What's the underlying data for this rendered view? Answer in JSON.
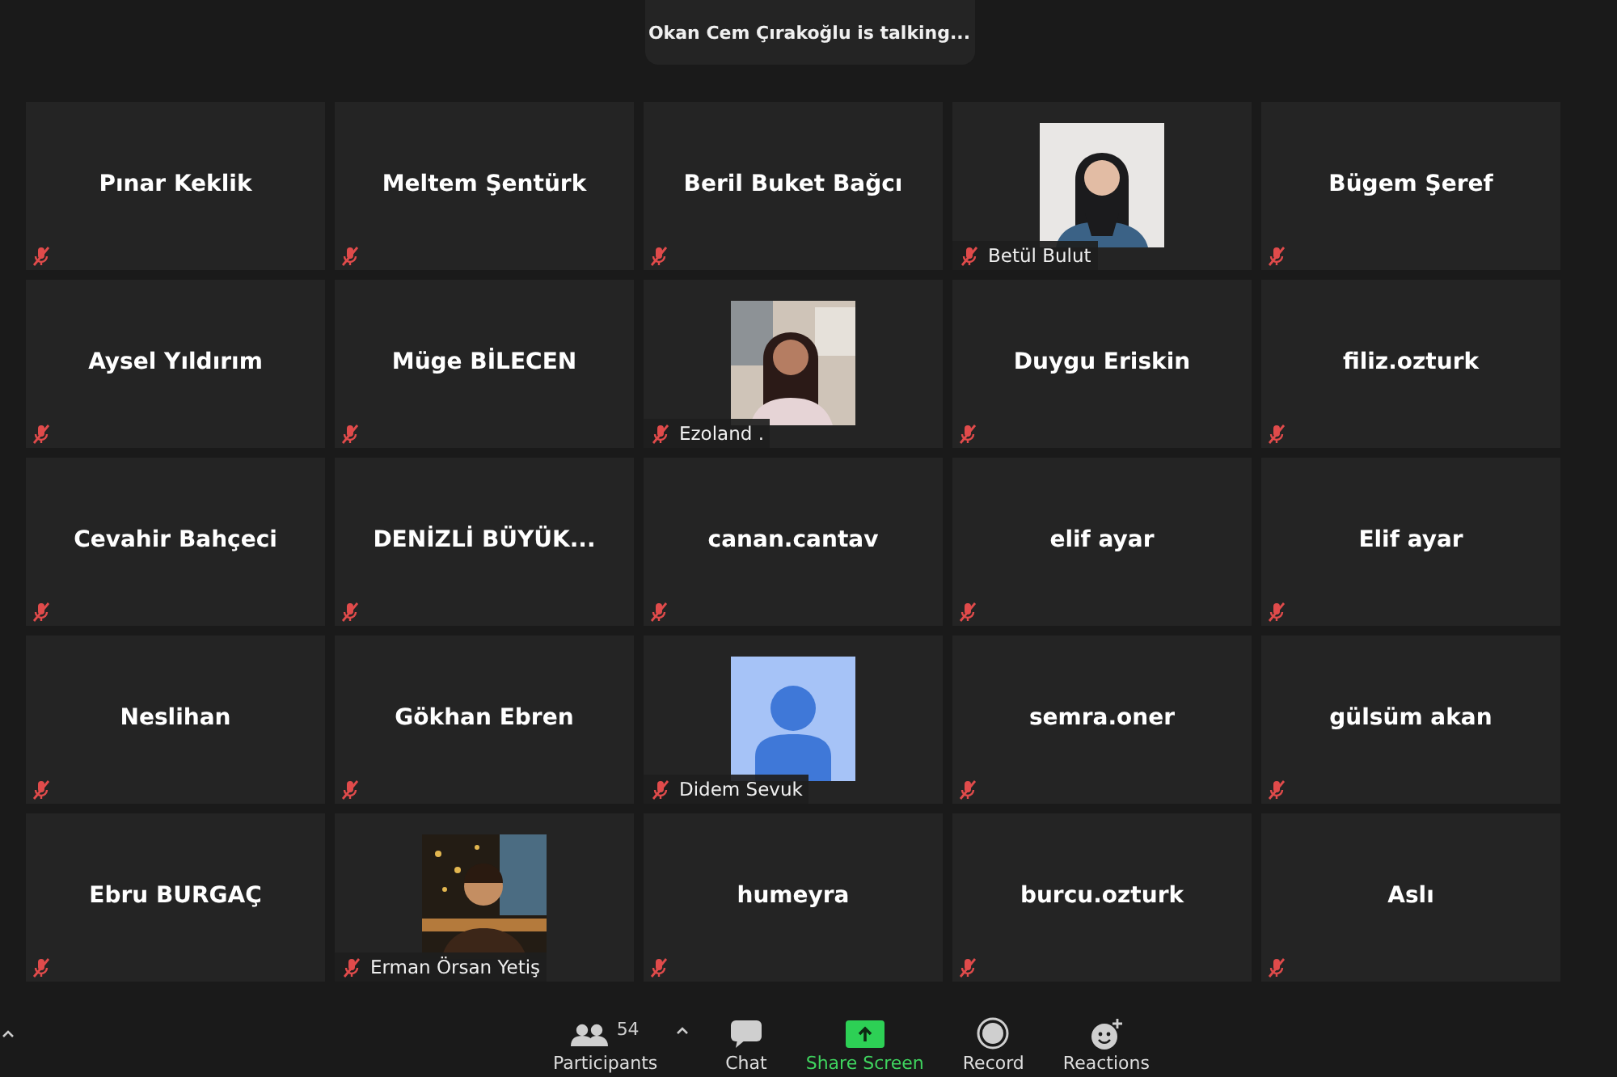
{
  "banner": {
    "text": "Okan Cem Çırakoğlu is talking..."
  },
  "tiles": [
    {
      "name": "Pınar Keklik",
      "kind": "name",
      "muted": true
    },
    {
      "name": "Meltem Şentürk",
      "kind": "name",
      "muted": true
    },
    {
      "name": "Beril Buket Bağcı",
      "kind": "name",
      "muted": true
    },
    {
      "name": "Betül Bulut",
      "muted": true
    },
    {
      "name": "Bügem Şeref",
      "kind": "name",
      "muted": true
    },
    {
      "name": "Aysel Yıldırım",
      "kind": "name",
      "muted": true
    },
    {
      "name": "Müge BİLECEN",
      "kind": "name",
      "muted": true
    },
    {
      "name": "Ezoland .",
      "muted": true
    },
    {
      "name": "Duygu Eriskin",
      "kind": "name",
      "muted": true
    },
    {
      "name": "filiz.ozturk",
      "kind": "name",
      "muted": true
    },
    {
      "name": "Cevahir Bahçeci",
      "kind": "name",
      "muted": true
    },
    {
      "name": "DENİZLİ BÜYÜK...",
      "kind": "name",
      "muted": true
    },
    {
      "name": "canan.cantav",
      "kind": "name",
      "muted": true
    },
    {
      "name": "elif ayar",
      "kind": "name",
      "muted": true
    },
    {
      "name": "Elif ayar",
      "kind": "name",
      "muted": true
    },
    {
      "name": "Neslihan",
      "kind": "name",
      "muted": true
    },
    {
      "name": "Gökhan Ebren",
      "kind": "name",
      "muted": true
    },
    {
      "name": "Didem Sevuk",
      "kind": "avatar",
      "muted": true
    },
    {
      "name": "semra.oner",
      "kind": "name",
      "muted": true
    },
    {
      "name": "gülsüm akan",
      "kind": "name",
      "muted": true
    },
    {
      "name": "Ebru BURGAÇ",
      "kind": "name",
      "muted": true
    },
    {
      "name": "Erman Örsan Yetiş",
      "muted": true
    },
    {
      "name": "humeyra",
      "kind": "name",
      "muted": true
    },
    {
      "name": "burcu.ozturk",
      "kind": "name",
      "muted": true
    },
    {
      "name": "Aslı",
      "kind": "name",
      "muted": true
    }
  ],
  "toolbar": {
    "items": [
      {
        "label": "Participants",
        "kind": "participants",
        "count": "54"
      },
      {
        "label": "Chat",
        "kind": "chat"
      },
      {
        "label": "Share Screen",
        "kind": "share"
      },
      {
        "label": "Record",
        "kind": "record"
      },
      {
        "label": "Reactions",
        "kind": "reactions"
      }
    ]
  }
}
